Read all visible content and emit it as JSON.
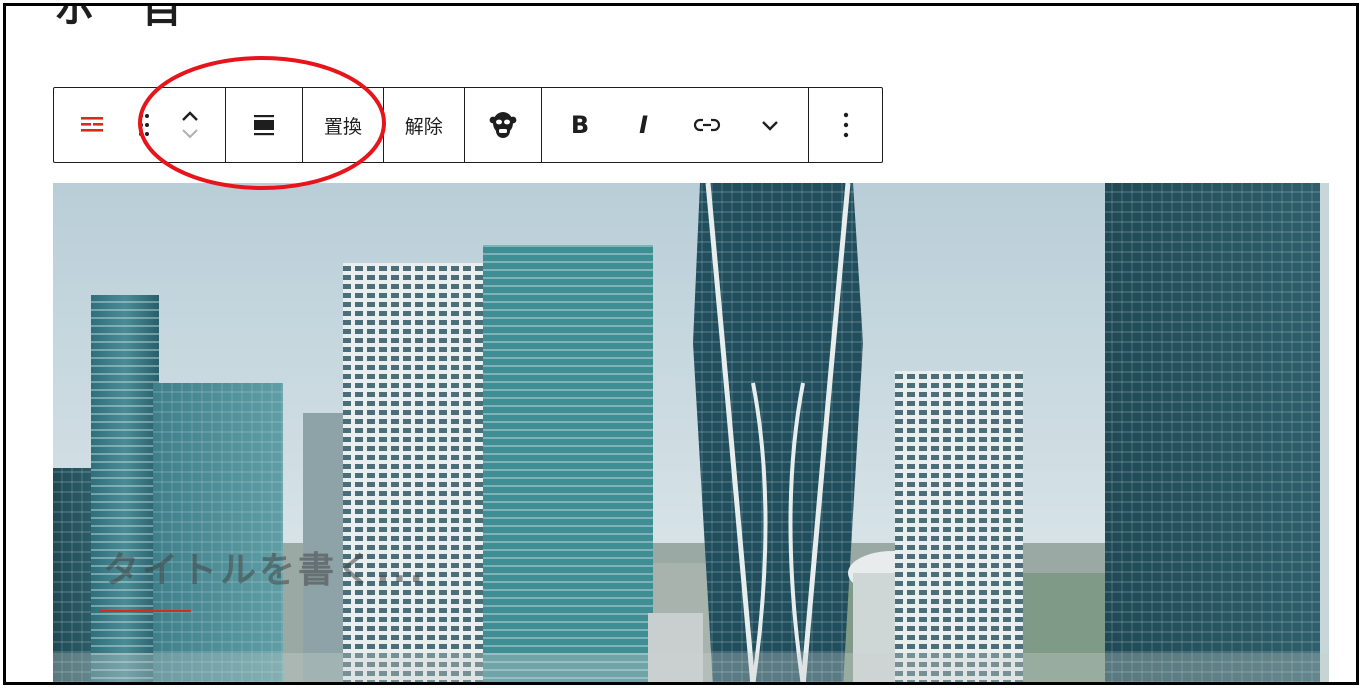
{
  "page": {
    "heading_fragment": "ホ　目"
  },
  "toolbar": {
    "replace_label": "置換",
    "unlink_label": "解除",
    "bold_label": "B",
    "italic_label": "I",
    "icons": [
      "block-type-icon",
      "drag-handle-icon",
      "move-up-icon",
      "move-down-icon",
      "align-icon",
      "monkey-icon",
      "link-icon",
      "chevron-down-icon",
      "more-options-icon"
    ]
  },
  "cover": {
    "title_placeholder": "タイトルを書く..."
  },
  "colors": {
    "accent": "#d62b1f",
    "highlight": "#e8141b",
    "border": "#1e1e1e"
  }
}
